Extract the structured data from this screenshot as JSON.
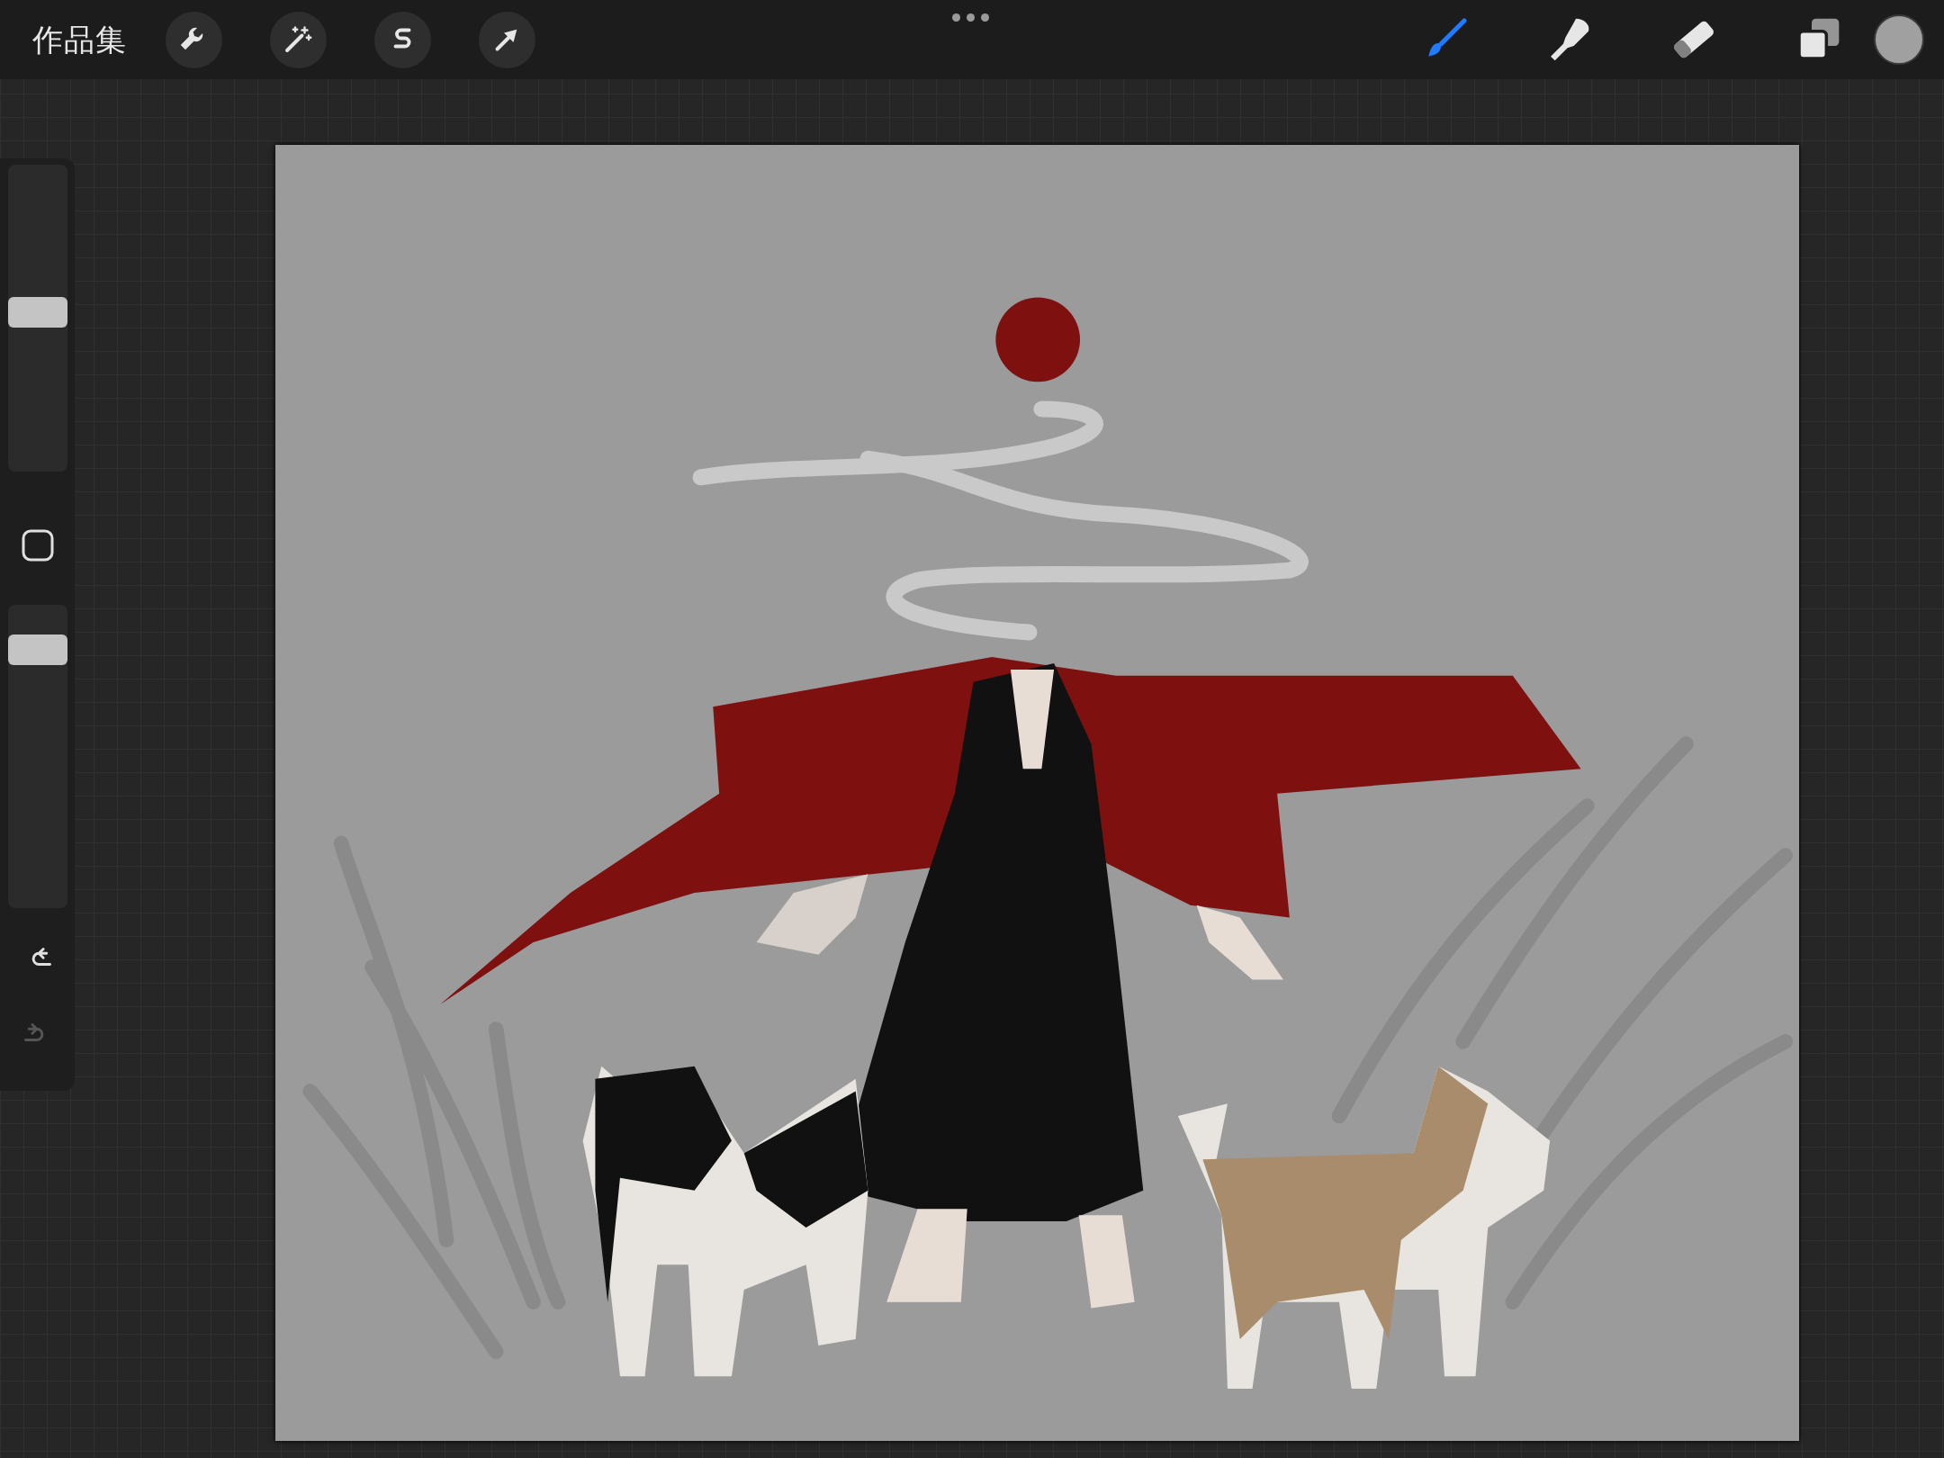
{
  "top_bar": {
    "gallery_label": "作品集",
    "actions": [
      {
        "kind": "actions"
      },
      {
        "kind": "adjustments"
      },
      {
        "kind": "selection"
      },
      {
        "kind": "transform"
      }
    ],
    "tools": [
      {
        "kind": "brush",
        "selected": true
      },
      {
        "kind": "smudge",
        "selected": false
      },
      {
        "kind": "eraser",
        "selected": false
      },
      {
        "kind": "layers",
        "selected": false
      }
    ]
  },
  "sidebar": {
    "size_slider": {
      "level": 0.52
    },
    "opacity_slider": {
      "level": 0.89
    },
    "undo": {
      "disabled": false
    },
    "redo": {
      "disabled": true
    }
  }
}
